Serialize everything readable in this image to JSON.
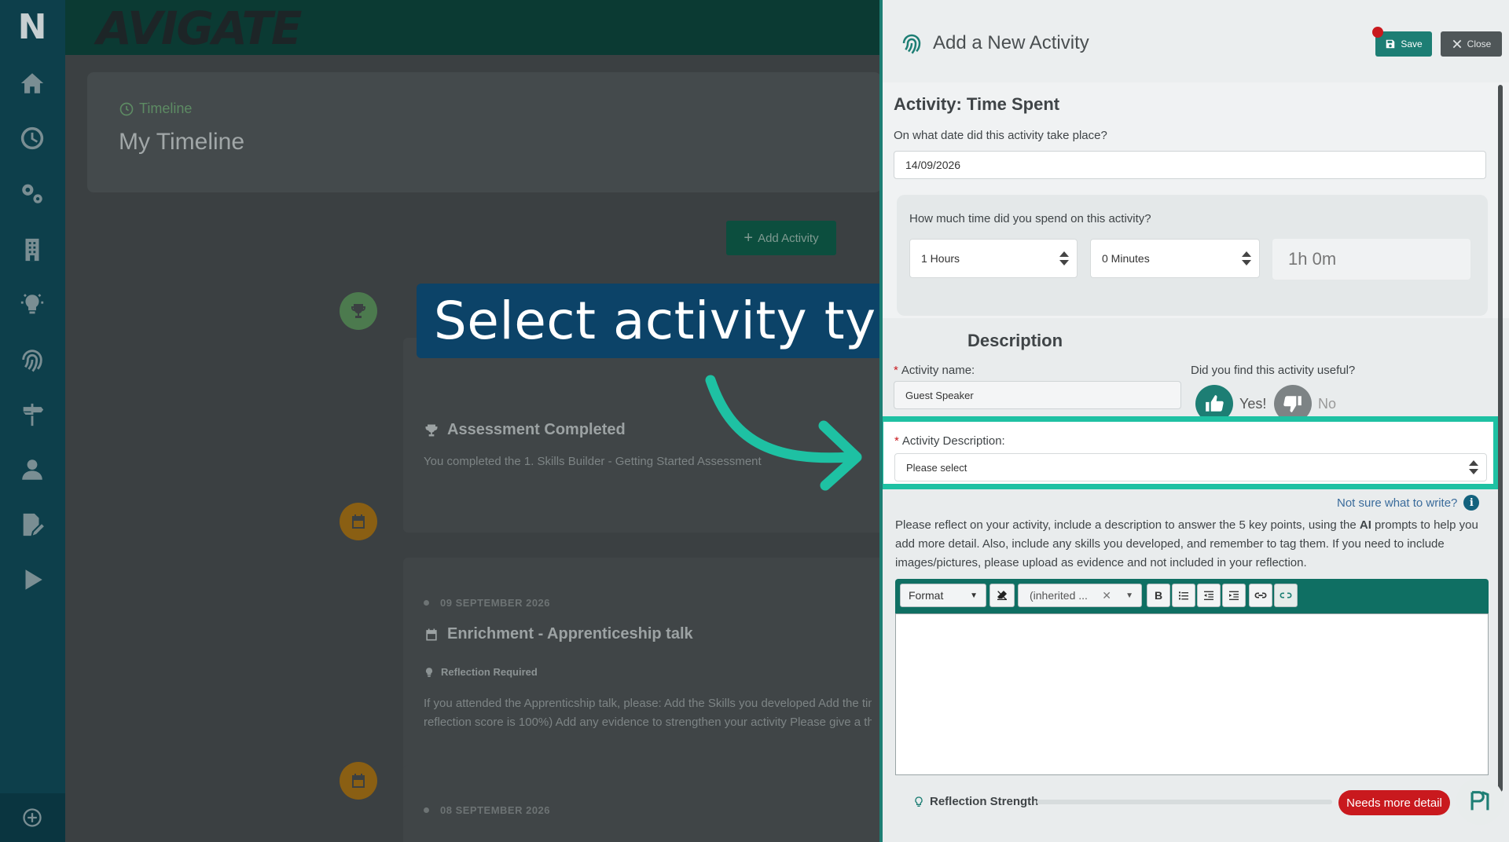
{
  "sidebar": {
    "logo": "N",
    "icons": [
      "home-icon",
      "clock-icon",
      "cogs-icon",
      "building-icon",
      "lightbulb-icon",
      "fingerprint-icon",
      "signpost-icon",
      "user-icon",
      "edit-document-icon",
      "play-icon",
      "plus-circle-icon"
    ]
  },
  "topbar": {
    "brand": "AVIGATE"
  },
  "main": {
    "breadcrumb": "Timeline",
    "page_title": "My Timeline",
    "add_activity_label": "Add Activity",
    "cards": [
      {
        "title": "Assessment Completed",
        "text": "You completed the 1. Skills Builder - Getting Started Assessment",
        "badge_color": "#4c7a4e"
      },
      {
        "date": "09 SEPTEMBER 2026",
        "title": "Enrichment - Apprenticeship talk",
        "tag": "Reflection Required",
        "text_line1": "If you attended the Apprenticship talk, please: Add the Skills you developed Add the time",
        "text_line2": "reflection score is 100%) Add any evidence to strengthen your activity Please give a thu",
        "badge_color": "#8a5f13"
      },
      {
        "date": "08 SEPTEMBER 2026",
        "badge_color": "#8a5f13"
      }
    ]
  },
  "callout": {
    "text": "Select activity type",
    "arrow_color": "#1ec1a3"
  },
  "panel": {
    "title": "Add a New Activity",
    "save_label": "Save",
    "close_label": "Close",
    "activity_heading": "Activity: Time Spent",
    "date_question": "On what date did this activity take place?",
    "date_value": "14/09/2026",
    "time_question": "How much time did you spend on this activity?",
    "hours_value": "1 Hours",
    "minutes_value": "0 Minutes",
    "total_time": "1h 0m",
    "description_heading": "Description",
    "name_label": "Activity name:",
    "name_value": "Guest Speaker",
    "useful_question": "Did you find this activity useful?",
    "yes_label": "Yes!",
    "no_label": "No",
    "activity_desc_label": "Activity Description:",
    "activity_desc_value": "Please select",
    "not_sure_link": "Not sure what to write?",
    "instructions_before_ai": "Please reflect on your activity, include a description to answer the 5 key points, using the ",
    "instructions_ai": "AI",
    "instructions_after_ai": " prompts to help you add more detail. Also, include any skills you developed, and remember to tag them. If you need to include images/pictures, please upload as evidence and not included in your reflection.",
    "editor": {
      "format_label": "Format",
      "font_label": "(inherited ..."
    },
    "reflection_strength_label": "Reflection Strength",
    "needs_detail_label": "Needs more detail"
  },
  "colors": {
    "accent": "#1d7e74",
    "highlight": "#1ec1a3",
    "danger": "#c9191e",
    "callout_bg": "#0c4368"
  }
}
